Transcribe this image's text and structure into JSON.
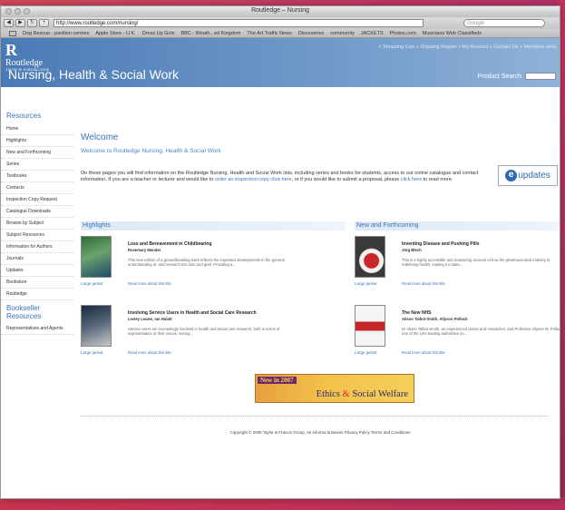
{
  "window": {
    "title": "Routledge – Nursing"
  },
  "toolbar": {
    "url": "http://www.routledge.com/nursing/",
    "search_placeholder": "Google"
  },
  "bookmarks": [
    "Dog Rescue - pavilion centres",
    "Apple Store - U.K.",
    "Dress Up Girls",
    "BBC - Weath.. ed Kingdom",
    "The Art Traffic News",
    "Discoveries",
    "community",
    "JACKETS",
    "Photos.com",
    "Musicians Web Classifieds"
  ],
  "site": {
    "logo_name": "Routledge",
    "logo_sub": "Taylor & Francis Group",
    "title": "Nursing, Health & Social Work",
    "topnav": "» Shopping Cart » Shipping Region » My Account » Contact Us » Members area",
    "product_search_label": "Product Search"
  },
  "sidebar": {
    "heading": "Resources",
    "items": [
      "Home",
      "Highlights",
      "New and Forthcoming",
      "Series",
      "Textbooks",
      "Contacts",
      "Inspection Copy Request",
      "Catalogue Downloads",
      "Browse by Subject",
      "Subject Resources",
      "Information for Authors",
      "Journals",
      "Updates",
      "Bookstore",
      "Routledge"
    ],
    "heading2": "Bookseller Resources",
    "items2": [
      "Representatives and Agents"
    ]
  },
  "main": {
    "welcome": "Welcome",
    "welcome_sub": "Welcome to Routledge Nursing, Health & Social Work",
    "intro_a": "On these pages you will find information on the Routledge Nursing, Health and Social Work lists, including series and books for students, access to our online catalogue and contact information. If you are a teacher or lecturer and would like to ",
    "intro_link1": "order an inspection copy click here",
    "intro_b": ", or if you would like to submit a proposal, please ",
    "intro_link2": "click here",
    "intro_c": " to read more.",
    "eupdates": "updates",
    "highlights_title": "Highlights",
    "newforth_title": "New and Forthcoming",
    "jacket_label": "Large jacket",
    "more_label": "Read more about this title",
    "highlights": [
      {
        "title": "Loss and Bereavement in Childbearing",
        "author": "Rosemary Mander",
        "desc": "This new edition of a groundbreaking work reflects the important developments in the general understanding of, and research into loss and grief. Providing a..."
      },
      {
        "title": "Involving Service Users in Health and Social Care Research",
        "author": "Lesley Lowes, Ian Hulatt",
        "desc": "Service users are increasingly involved in health and social care research, both in terms of representation of their voices, seeing..."
      }
    ],
    "newforth": [
      {
        "title": "Inventing Disease and Pushing Pills",
        "author": "Jörg Blech",
        "desc": "This is a highly accessible and reassuring account of how the pharmaceutical industry is redefining health, making it a state..."
      },
      {
        "title": "The New NHS",
        "author": "Alison Talbot-Smith, Allyson Pollock",
        "desc": "Dr Alison Talbot-Smith, an experienced doctor and researcher, and Professor Allyson M. Pollock, one of the UKs leading authorities on..."
      }
    ],
    "banner_tag": "New in 2007",
    "banner_text_a": "Ethics ",
    "banner_amp": "&",
    "banner_text_b": " Social Welfare",
    "footer": "Copyright © 2005 Taylor & Francis Group, an informa business    Privacy Policy    Terms and Conditions"
  }
}
